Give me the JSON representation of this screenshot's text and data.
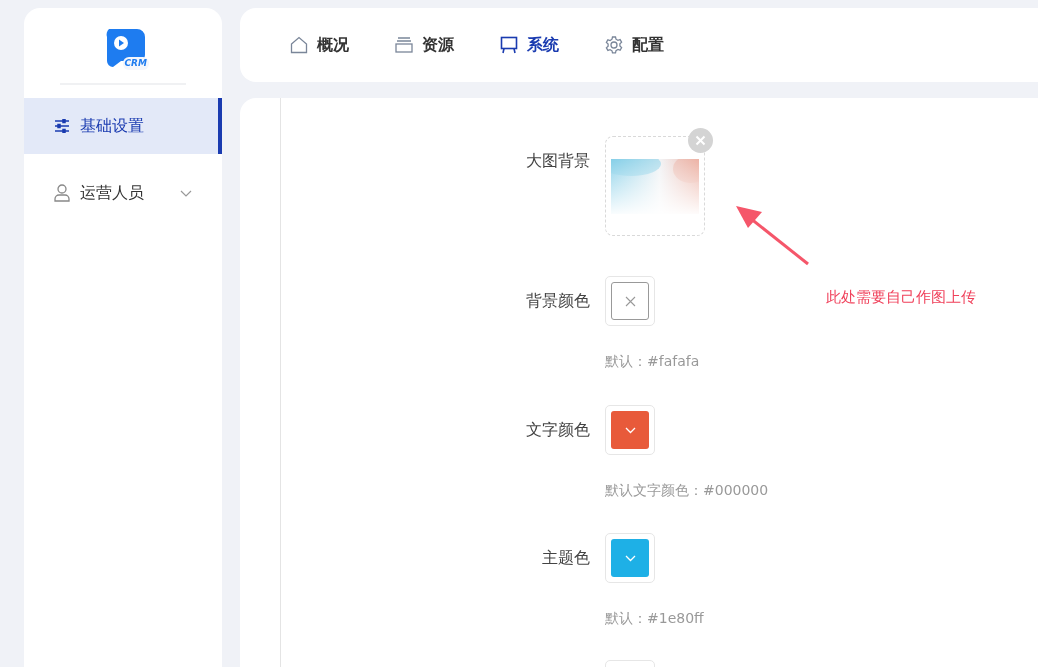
{
  "logo": {
    "text": "CRM"
  },
  "sidebar": {
    "items": [
      {
        "label": "基础设置",
        "selected": true,
        "expandable": false
      },
      {
        "label": "运营人员",
        "selected": false,
        "expandable": true
      }
    ]
  },
  "top_nav": {
    "items": [
      {
        "label": "概况",
        "selected": false
      },
      {
        "label": "资源",
        "selected": false
      },
      {
        "label": "系统",
        "selected": true
      },
      {
        "label": "配置",
        "selected": false
      }
    ]
  },
  "form": {
    "fields": [
      {
        "label": "大图背景",
        "removable": true
      },
      {
        "kind": "color",
        "label": "背景颜色",
        "hint": "默认：#fafafa"
      },
      {
        "kind": "color",
        "label": "文字颜色",
        "color": "#e85a3a",
        "hint": "默认文字颜色：#000000"
      },
      {
        "kind": "color",
        "label": "主题色",
        "color": "#1eb0e6",
        "hint": "默认：#1e80ff"
      },
      {
        "kind": "clipped"
      }
    ]
  },
  "annotation": {
    "text": "此处需要自己作图上传"
  }
}
